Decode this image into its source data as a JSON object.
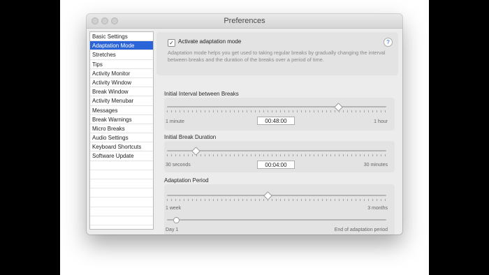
{
  "window": {
    "title": "Preferences"
  },
  "sidebar": {
    "items": [
      {
        "label": "Basic Settings",
        "selected": false
      },
      {
        "label": "Adaptation Mode",
        "selected": true
      },
      {
        "label": "Stretches",
        "selected": false
      },
      {
        "label": "Tips",
        "selected": false
      },
      {
        "label": "Activity Monitor",
        "selected": false
      },
      {
        "label": "Activity Window",
        "selected": false
      },
      {
        "label": "Break Window",
        "selected": false
      },
      {
        "label": "Activity Menubar",
        "selected": false
      },
      {
        "label": "Messages",
        "selected": false
      },
      {
        "label": "Break Warnings",
        "selected": false
      },
      {
        "label": "Micro Breaks",
        "selected": false
      },
      {
        "label": "Audio Settings",
        "selected": false
      },
      {
        "label": "Keyboard Shortcuts",
        "selected": false
      },
      {
        "label": "Software Update",
        "selected": false
      }
    ]
  },
  "adaptation": {
    "checkbox_label": "Activate adaptation mode",
    "checked": true,
    "help": "?",
    "description": "Adaptation mode helps you get used to taking regular breaks by gradually changing the interval between breaks and the duration of the breaks over a period of time."
  },
  "interval": {
    "label": "Initial Interval between Breaks",
    "min_label": "1 minute",
    "max_label": "1 hour",
    "value": "00:48:00",
    "slider_fraction": 0.79
  },
  "duration": {
    "label": "Initial Break Duration",
    "min_label": "30 seconds",
    "max_label": "30 minutes",
    "value": "00:04:00",
    "slider_fraction": 0.12
  },
  "period": {
    "label": "Adaptation Period",
    "min_label": "1 week",
    "max_label": "3 months",
    "slider_fraction": 0.46,
    "progress_min_label": "Day 1",
    "progress_max_label": "End of adaptation period",
    "progress_fraction": 0.03
  }
}
